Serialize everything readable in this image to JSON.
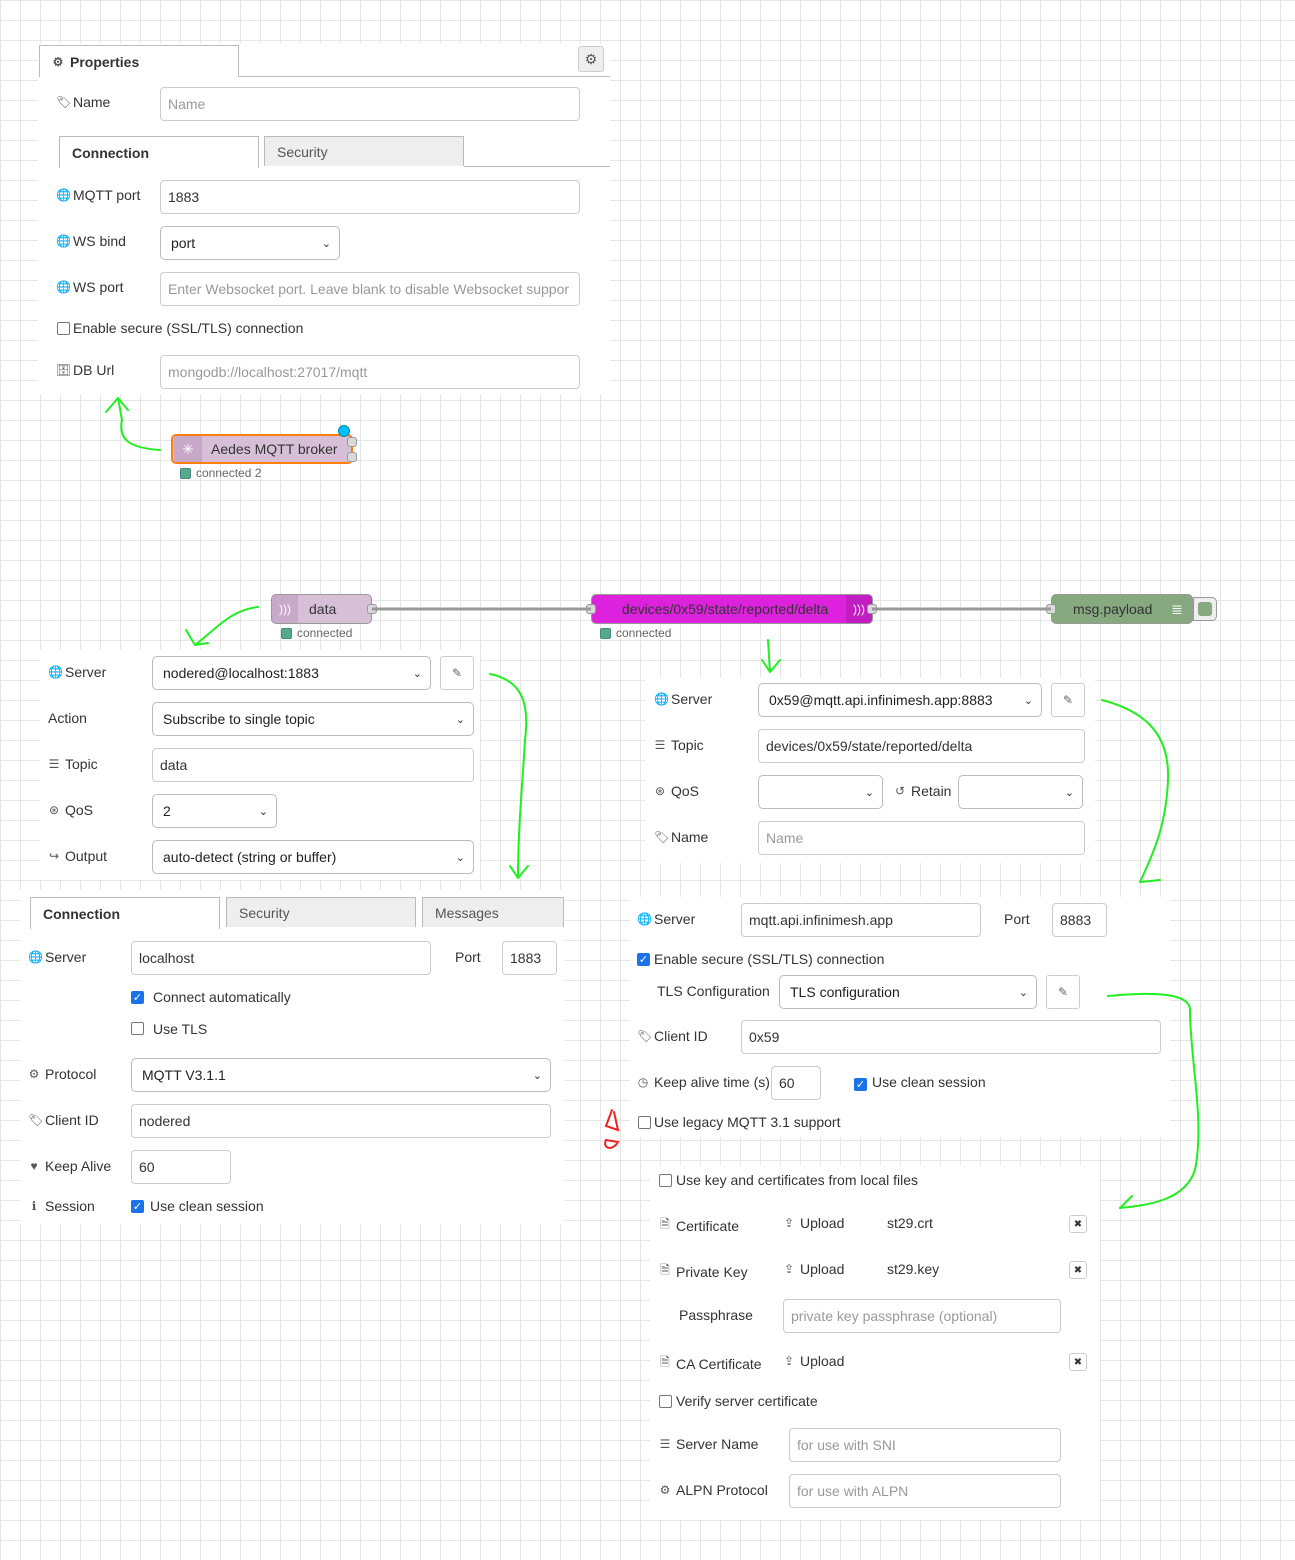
{
  "aedes": {
    "tab_title": "Properties",
    "name_label": "Name",
    "name_placeholder": "Name",
    "tabs": [
      "Connection",
      "Security"
    ],
    "mqtt_port_label": "MQTT port",
    "mqtt_port_value": "1883",
    "ws_bind_label": "WS bind",
    "ws_bind_value": "port",
    "ws_port_label": "WS port",
    "ws_port_placeholder": "Enter Websocket port. Leave blank to disable Websocket suppor",
    "ssl_label": "Enable secure (SSL/TLS) connection",
    "db_url_label": "DB Url",
    "db_url_placeholder": "mongodb://localhost:27017/mqtt"
  },
  "flow": {
    "broker_node": {
      "label": "Aedes MQTT broker",
      "status": "connected 2"
    },
    "data_node": {
      "label": "data",
      "status": "connected"
    },
    "delta_node": {
      "label": "devices/0x59/state/reported/delta",
      "status": "connected"
    },
    "debug_node": {
      "label": "msg.payload"
    }
  },
  "mqtt_in": {
    "server_label": "Server",
    "server_value": "nodered@localhost:1883",
    "action_label": "Action",
    "action_value": "Subscribe to single topic",
    "topic_label": "Topic",
    "topic_value": "data",
    "qos_label": "QoS",
    "qos_value": "2",
    "output_label": "Output",
    "output_value": "auto-detect (string or buffer)"
  },
  "mqtt_out": {
    "server_label": "Server",
    "server_value": "0x59@mqtt.api.infinimesh.app:8883",
    "topic_label": "Topic",
    "topic_value": "devices/0x59/state/reported/delta",
    "qos_label": "QoS",
    "retain_label": "Retain",
    "name_label": "Name",
    "name_placeholder": "Name"
  },
  "broker_local": {
    "tabs": [
      "Connection",
      "Security",
      "Messages"
    ],
    "server_label": "Server",
    "server_value": "localhost",
    "port_label": "Port",
    "port_value": "1883",
    "connect_auto_label": "Connect automatically",
    "use_tls_label": "Use TLS",
    "protocol_label": "Protocol",
    "protocol_value": "MQTT V3.1.1",
    "client_id_label": "Client ID",
    "client_id_value": "nodered",
    "keep_alive_label": "Keep Alive",
    "keep_alive_value": "60",
    "session_label": "Session",
    "clean_session_label": "Use clean session"
  },
  "broker_remote": {
    "server_label": "Server",
    "server_value": "mqtt.api.infinimesh.app",
    "port_label": "Port",
    "port_value": "8883",
    "ssl_label": "Enable secure (SSL/TLS) connection",
    "tls_config_label": "TLS Configuration",
    "tls_config_value": "TLS configuration",
    "client_id_label": "Client ID",
    "client_id_value": "0x59",
    "keep_alive_label": "Keep alive time (s)",
    "keep_alive_value": "60",
    "clean_session_label": "Use clean session",
    "legacy_label": "Use legacy MQTT 3.1 support"
  },
  "tls": {
    "local_files_label": "Use key and certificates from local files",
    "certificate_label": "Certificate",
    "upload_label": "Upload",
    "certificate_file": "st29.crt",
    "private_key_label": "Private Key",
    "private_key_file": "st29.key",
    "passphrase_label": "Passphrase",
    "passphrase_placeholder": "private key passphrase (optional)",
    "ca_label": "CA Certificate",
    "verify_label": "Verify server certificate",
    "server_name_label": "Server Name",
    "server_name_placeholder": "for use with SNI",
    "alpn_label": "ALPN Protocol",
    "alpn_placeholder": "for use with ALPN"
  },
  "colors": {
    "accent_green": "#22ee22",
    "annotation_red": "#ee2222",
    "broker_node": "#d8bfd8",
    "mqtt_in_node": "#d8bfd8",
    "mqtt_out_node": "#dd22dd",
    "debug_node": "#87a980"
  }
}
